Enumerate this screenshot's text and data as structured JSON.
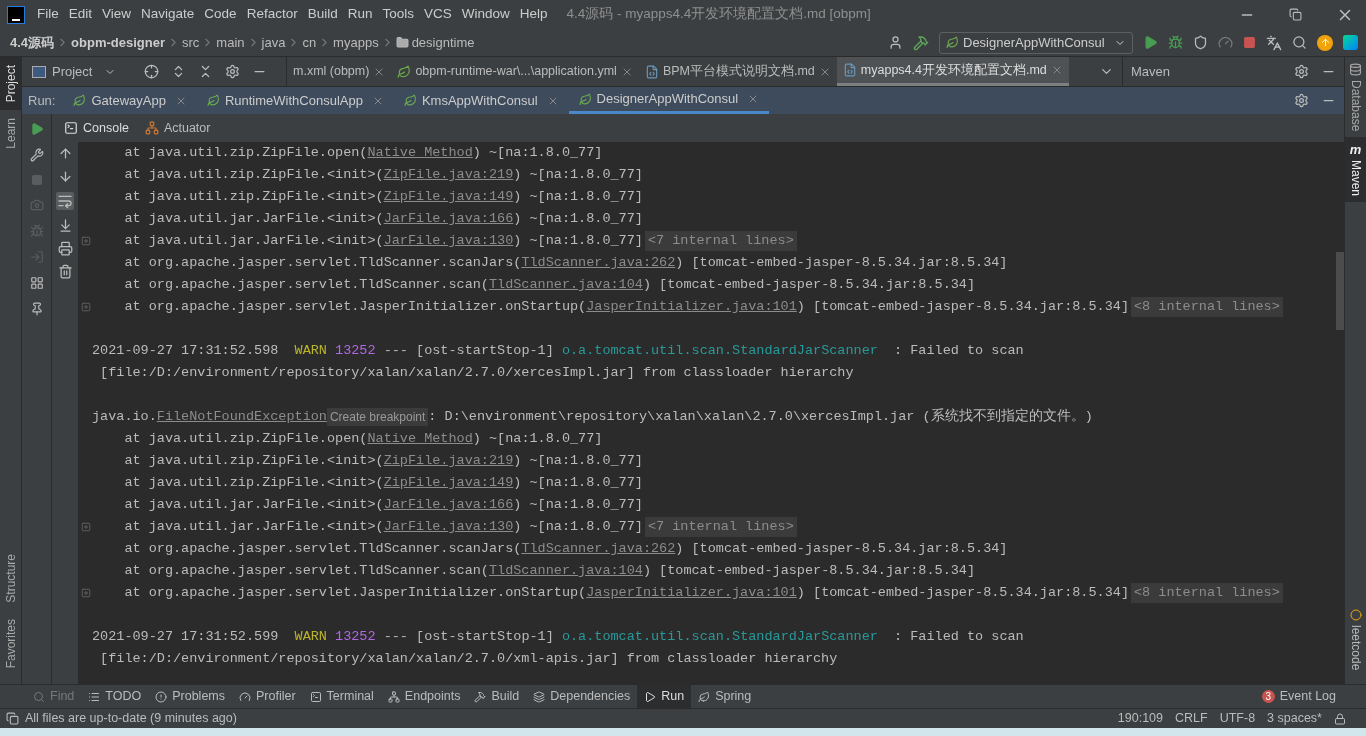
{
  "window": {
    "title": "4.4源码 - myapps4.4开发环境配置文档.md [obpm]"
  },
  "menu": [
    "File",
    "Edit",
    "View",
    "Navigate",
    "Code",
    "Refactor",
    "Build",
    "Run",
    "Tools",
    "VCS",
    "Window",
    "Help"
  ],
  "breadcrumb": [
    {
      "label": "4.4源码",
      "kind": "project"
    },
    {
      "label": "obpm-designer",
      "kind": "module"
    },
    {
      "label": "src",
      "kind": "plain"
    },
    {
      "label": "main",
      "kind": "plain"
    },
    {
      "label": "java",
      "kind": "plain"
    },
    {
      "label": "cn",
      "kind": "plain"
    },
    {
      "label": "myapps",
      "kind": "plain"
    },
    {
      "label": "designtime",
      "kind": "folder"
    }
  ],
  "run_config": {
    "label": "DesignerAppWithConsul"
  },
  "left_stripe": [
    {
      "label": "Project",
      "selected": true,
      "kind": "top"
    },
    {
      "label": "Learn",
      "selected": false,
      "kind": "top"
    },
    {
      "label": "Structure",
      "selected": false,
      "kind": "bottom"
    },
    {
      "label": "Favorites",
      "selected": false,
      "kind": "bottom"
    }
  ],
  "project_panel": {
    "title": "Project"
  },
  "editor_tabs": [
    {
      "label": "m.xml (obpm)",
      "selected": false,
      "kind": "xml"
    },
    {
      "label": "obpm-runtime-war\\...\\application.yml",
      "selected": false,
      "kind": "yml"
    },
    {
      "label": "BPM平台模式说明文档.md",
      "selected": false,
      "kind": "md"
    },
    {
      "label": "myapps4.4开发环境配置文档.md",
      "selected": true,
      "kind": "md"
    }
  ],
  "maven_panel": {
    "title": "Maven"
  },
  "run": {
    "label": "Run:",
    "tabs": [
      {
        "label": "GatewayApp",
        "selected": false
      },
      {
        "label": "RuntimeWithConsulApp",
        "selected": false
      },
      {
        "label": "KmsAppWithConsul",
        "selected": false
      },
      {
        "label": "DesignerAppWithConsul",
        "selected": true
      }
    ]
  },
  "console_tabs": [
    {
      "label": "Console",
      "selected": true,
      "kind": "console"
    },
    {
      "label": "Actuator",
      "selected": false,
      "kind": "actuator"
    }
  ],
  "console": [
    {
      "kind": "log",
      "foldable": false,
      "segments": [
        {
          "kind": "text",
          "text": "    at java.util.zip.ZipFile.open("
        },
        {
          "kind": "link",
          "text": "Native Method"
        },
        {
          "kind": "text",
          "text": ") ~[na:1.8.0_77]"
        }
      ]
    },
    {
      "kind": "log",
      "foldable": false,
      "segments": [
        {
          "kind": "text",
          "text": "    at java.util.zip.ZipFile.<init>("
        },
        {
          "kind": "link",
          "text": "ZipFile.java:219"
        },
        {
          "kind": "text",
          "text": ") ~[na:1.8.0_77]"
        }
      ]
    },
    {
      "kind": "log",
      "foldable": false,
      "segments": [
        {
          "kind": "text",
          "text": "    at java.util.zip.ZipFile.<init>("
        },
        {
          "kind": "link",
          "text": "ZipFile.java:149"
        },
        {
          "kind": "text",
          "text": ") ~[na:1.8.0_77]"
        }
      ]
    },
    {
      "kind": "log",
      "foldable": false,
      "segments": [
        {
          "kind": "text",
          "text": "    at java.util.jar.JarFile.<init>("
        },
        {
          "kind": "link",
          "text": "JarFile.java:166"
        },
        {
          "kind": "text",
          "text": ") ~[na:1.8.0_77]"
        }
      ]
    },
    {
      "kind": "log",
      "foldable": true,
      "segments": [
        {
          "kind": "text",
          "text": "    at java.util.jar.JarFile.<init>("
        },
        {
          "kind": "link",
          "text": "JarFile.java:130"
        },
        {
          "kind": "text",
          "text": ") ~[na:1.8.0_77]"
        },
        {
          "kind": "badge",
          "text": "<7 internal lines>"
        }
      ]
    },
    {
      "kind": "log",
      "foldable": false,
      "segments": [
        {
          "kind": "text",
          "text": "    at org.apache.jasper.servlet.TldScanner.scanJars("
        },
        {
          "kind": "link",
          "text": "TldScanner.java:262"
        },
        {
          "kind": "text",
          "text": ") [tomcat-embed-jasper-8.5.34.jar:8.5.34]"
        }
      ]
    },
    {
      "kind": "log",
      "foldable": false,
      "segments": [
        {
          "kind": "text",
          "text": "    at org.apache.jasper.servlet.TldScanner.scan("
        },
        {
          "kind": "link",
          "text": "TldScanner.java:104"
        },
        {
          "kind": "text",
          "text": ") [tomcat-embed-jasper-8.5.34.jar:8.5.34]"
        }
      ]
    },
    {
      "kind": "log",
      "foldable": true,
      "segments": [
        {
          "kind": "text",
          "text": "    at org.apache.jasper.servlet.JasperInitializer.onStartup("
        },
        {
          "kind": "link",
          "text": "JasperInitializer.java:101"
        },
        {
          "kind": "text",
          "text": ") [tomcat-embed-jasper-8.5.34.jar:8.5.34]"
        },
        {
          "kind": "badge",
          "text": "<8 internal lines>"
        }
      ]
    },
    {
      "kind": "blank"
    },
    {
      "kind": "log",
      "foldable": false,
      "segments": [
        {
          "kind": "text",
          "text": "2021-09-27 17:31:52.598  "
        },
        {
          "kind": "level",
          "text": "WARN"
        },
        {
          "kind": "pid",
          "text": "13252"
        },
        {
          "kind": "text",
          "text": " --- [ost-startStop-1] "
        },
        {
          "kind": "logger",
          "text": "o.a.tomcat.util.scan.StandardJarScanner"
        },
        {
          "kind": "text",
          "text": "  : Failed to scan"
        }
      ]
    },
    {
      "kind": "log",
      "foldable": false,
      "segments": [
        {
          "kind": "text",
          "text": " [file:/D:/environment/repository/xalan/xalan/2.7.0/xercesImpl.jar] from classloader hierarchy"
        }
      ]
    },
    {
      "kind": "blank"
    },
    {
      "kind": "log",
      "foldable": false,
      "segments": [
        {
          "kind": "text",
          "text": "java.io."
        },
        {
          "kind": "link",
          "text": "FileNotFoundException"
        },
        {
          "kind": "hint",
          "text": "Create breakpoint"
        },
        {
          "kind": "text",
          "text": ": D:\\environment\\repository\\xalan\\xalan\\2.7.0\\xercesImpl.jar (系统找不到指定的文件。)"
        }
      ]
    },
    {
      "kind": "log",
      "foldable": false,
      "segments": [
        {
          "kind": "text",
          "text": "    at java.util.zip.ZipFile.open("
        },
        {
          "kind": "link",
          "text": "Native Method"
        },
        {
          "kind": "text",
          "text": ") ~[na:1.8.0_77]"
        }
      ]
    },
    {
      "kind": "log",
      "foldable": false,
      "segments": [
        {
          "kind": "text",
          "text": "    at java.util.zip.ZipFile.<init>("
        },
        {
          "kind": "link",
          "text": "ZipFile.java:219"
        },
        {
          "kind": "text",
          "text": ") ~[na:1.8.0_77]"
        }
      ]
    },
    {
      "kind": "log",
      "foldable": false,
      "segments": [
        {
          "kind": "text",
          "text": "    at java.util.zip.ZipFile.<init>("
        },
        {
          "kind": "link",
          "text": "ZipFile.java:149"
        },
        {
          "kind": "text",
          "text": ") ~[na:1.8.0_77]"
        }
      ]
    },
    {
      "kind": "log",
      "foldable": false,
      "segments": [
        {
          "kind": "text",
          "text": "    at java.util.jar.JarFile.<init>("
        },
        {
          "kind": "link",
          "text": "JarFile.java:166"
        },
        {
          "kind": "text",
          "text": ") ~[na:1.8.0_77]"
        }
      ]
    },
    {
      "kind": "log",
      "foldable": true,
      "segments": [
        {
          "kind": "text",
          "text": "    at java.util.jar.JarFile.<init>("
        },
        {
          "kind": "link",
          "text": "JarFile.java:130"
        },
        {
          "kind": "text",
          "text": ") ~[na:1.8.0_77]"
        },
        {
          "kind": "badge",
          "text": "<7 internal lines>"
        }
      ]
    },
    {
      "kind": "log",
      "foldable": false,
      "segments": [
        {
          "kind": "text",
          "text": "    at org.apache.jasper.servlet.TldScanner.scanJars("
        },
        {
          "kind": "link",
          "text": "TldScanner.java:262"
        },
        {
          "kind": "text",
          "text": ") [tomcat-embed-jasper-8.5.34.jar:8.5.34]"
        }
      ]
    },
    {
      "kind": "log",
      "foldable": false,
      "segments": [
        {
          "kind": "text",
          "text": "    at org.apache.jasper.servlet.TldScanner.scan("
        },
        {
          "kind": "link",
          "text": "TldScanner.java:104"
        },
        {
          "kind": "text",
          "text": ") [tomcat-embed-jasper-8.5.34.jar:8.5.34]"
        }
      ]
    },
    {
      "kind": "log",
      "foldable": true,
      "segments": [
        {
          "kind": "text",
          "text": "    at org.apache.jasper.servlet.JasperInitializer.onStartup("
        },
        {
          "kind": "link",
          "text": "JasperInitializer.java:101"
        },
        {
          "kind": "text",
          "text": ") [tomcat-embed-jasper-8.5.34.jar:8.5.34]"
        },
        {
          "kind": "badge",
          "text": "<8 internal lines>"
        }
      ]
    },
    {
      "kind": "blank"
    },
    {
      "kind": "log",
      "foldable": false,
      "segments": [
        {
          "kind": "text",
          "text": "2021-09-27 17:31:52.599  "
        },
        {
          "kind": "level",
          "text": "WARN"
        },
        {
          "kind": "pid",
          "text": "13252"
        },
        {
          "kind": "text",
          "text": " --- [ost-startStop-1] "
        },
        {
          "kind": "logger",
          "text": "o.a.tomcat.util.scan.StandardJarScanner"
        },
        {
          "kind": "text",
          "text": "  : Failed to scan"
        }
      ]
    },
    {
      "kind": "log",
      "foldable": false,
      "segments": [
        {
          "kind": "text",
          "text": " [file:/D:/environment/repository/xalan/xalan/2.7.0/xml-apis.jar] from classloader hierarchy"
        }
      ]
    }
  ],
  "bottom_tools": [
    {
      "label": "Find",
      "kind": "find",
      "selected": false,
      "disabled": true
    },
    {
      "label": "TODO",
      "kind": "todo",
      "selected": false,
      "disabled": false
    },
    {
      "label": "Problems",
      "kind": "problems",
      "selected": false,
      "disabled": false
    },
    {
      "label": "Profiler",
      "kind": "profiler",
      "selected": false,
      "disabled": false
    },
    {
      "label": "Terminal",
      "kind": "terminal",
      "selected": false,
      "disabled": false
    },
    {
      "label": "Endpoints",
      "kind": "endpoints",
      "selected": false,
      "disabled": false
    },
    {
      "label": "Build",
      "kind": "build",
      "selected": false,
      "disabled": false
    },
    {
      "label": "Dependencies",
      "kind": "dependencies",
      "selected": false,
      "disabled": false
    },
    {
      "label": "Run",
      "kind": "run",
      "selected": true,
      "disabled": false
    },
    {
      "label": "Spring",
      "kind": "spring",
      "selected": false,
      "disabled": false
    }
  ],
  "event_log": {
    "count": "3",
    "label": "Event Log"
  },
  "status_bar": {
    "message": "All files are up-to-date (9 minutes ago)",
    "position": "190:109",
    "line_separator": "CRLF",
    "encoding": "UTF-8",
    "indent": "3 spaces*"
  },
  "right_stripe": [
    {
      "label": "Database",
      "selected": false,
      "kind": "database"
    },
    {
      "label": "Maven",
      "selected": true,
      "kind": "maven",
      "icon_text": "m"
    },
    {
      "label": "leetcode",
      "selected": false,
      "kind": "leetcode"
    }
  ]
}
